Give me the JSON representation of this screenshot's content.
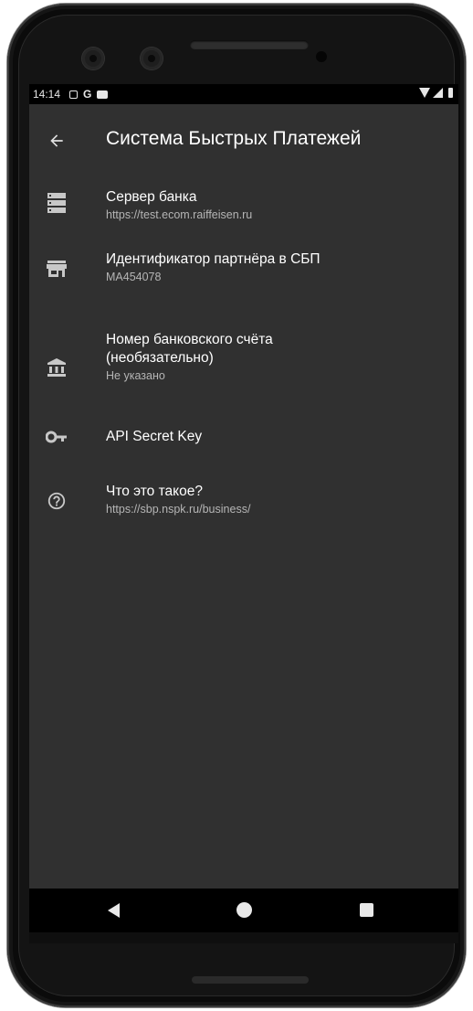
{
  "status_bar": {
    "time": "14:14",
    "notification_icons": [
      "notification-box-icon",
      "google-icon",
      "youtube-icon"
    ],
    "google_label": "G",
    "system_icons": [
      "wifi-icon",
      "signal-icon",
      "battery-icon"
    ]
  },
  "app_bar": {
    "title": "Система Быстрых Платежей",
    "back_icon": "arrow-back-icon"
  },
  "settings": {
    "items": [
      {
        "icon": "server-icon",
        "title": "Сервер банка",
        "summary": "https://test.ecom.raiffeisen.ru"
      },
      {
        "icon": "store-icon",
        "title": "Идентификатор партнёра в СБП",
        "summary": "MA454078"
      },
      {
        "icon": "bank-icon",
        "title": "Номер банковского счёта (необязательно)",
        "summary": "Не указано"
      },
      {
        "icon": "key-icon",
        "title": "API Secret Key",
        "summary": ""
      },
      {
        "icon": "help-circle-icon",
        "title": "Что это такое?",
        "summary": "https://sbp.nspk.ru/business/"
      }
    ]
  },
  "nav_bar": {
    "buttons": [
      "nav-back-icon",
      "nav-home-icon",
      "nav-recents-icon"
    ]
  },
  "colors": {
    "screen_background": "#303030",
    "bar_background": "#000000",
    "primary_text": "#ffffff",
    "secondary_text": "#b5b5b5",
    "icon_color": "#c8c8c8"
  }
}
